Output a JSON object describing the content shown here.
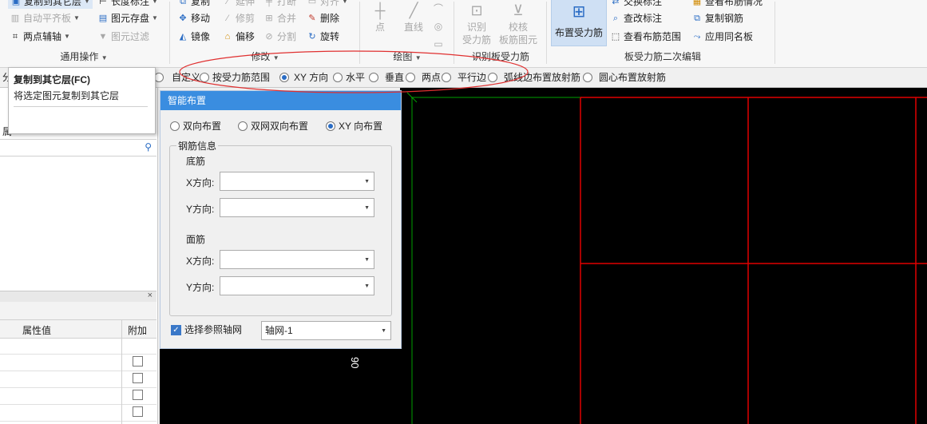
{
  "ribbon": {
    "general": {
      "copy_layer": "复制到其它层",
      "auto_flush": "自动平齐板",
      "two_point_axis": "两点辅轴",
      "length_mark": "长度标注",
      "element_save": "图元存盘",
      "element_filter": "图元过滤",
      "group_label": "通用操作"
    },
    "modify": {
      "copy": "复制",
      "extend": "延伸",
      "break": "打断",
      "align": "对齐",
      "move": "移动",
      "trim": "修剪",
      "merge": "合并",
      "delete": "删除",
      "mirror": "镜像",
      "offset": "偏移",
      "split": "分割",
      "rotate": "旋转",
      "group_label": "修改"
    },
    "draw": {
      "point": "点",
      "line": "直线",
      "group_label": "绘图"
    },
    "recognize": {
      "recognize_line1": "识别",
      "recognize_line2": "受力筋",
      "check_line1": "校核",
      "check_line2": "板筋图元",
      "group_label": "识别板受力筋"
    },
    "edit": {
      "place_bar": "布置受力筋",
      "swap_mark": "交换标注",
      "check_mark": "查改标注",
      "view_range": "查看布筋范围",
      "view_status": "查看布筋情况",
      "copy_bar": "复制钢筋",
      "apply_same": "应用同名板",
      "group_label": "板受力筋二次编辑"
    }
  },
  "optbar": {
    "cut_char": "分",
    "custom": "自定义",
    "by_range": "按受力筋范围",
    "xy_dir": "XY 方向",
    "horizontal": "水平",
    "vertical": "垂直",
    "two_point": "两点",
    "parallel_edge": "平行边",
    "arc_edge": "弧线边布置放射筋",
    "center_radial": "圆心布置放射筋"
  },
  "tooltip": {
    "title": "复制到其它层(FC)",
    "desc": "将选定图元复制到其它层"
  },
  "leftpanel": {
    "prop_value_header": "属性值",
    "extra_header": "附加",
    "fragment_char": "属",
    "close_char": "×"
  },
  "dialog": {
    "title": "智能布置",
    "radio_bi": "双向布置",
    "radio_net": "双网双向布置",
    "radio_xy": "XY 向布置",
    "rebar_info": "钢筋信息",
    "bottom": "底筋",
    "top": "面筋",
    "x_dir": "X方向:",
    "y_dir": "Y方向:",
    "ref_axis": "选择参照轴网",
    "axis_value": "轴网-1"
  },
  "canvas": {
    "dim_text": "90"
  }
}
